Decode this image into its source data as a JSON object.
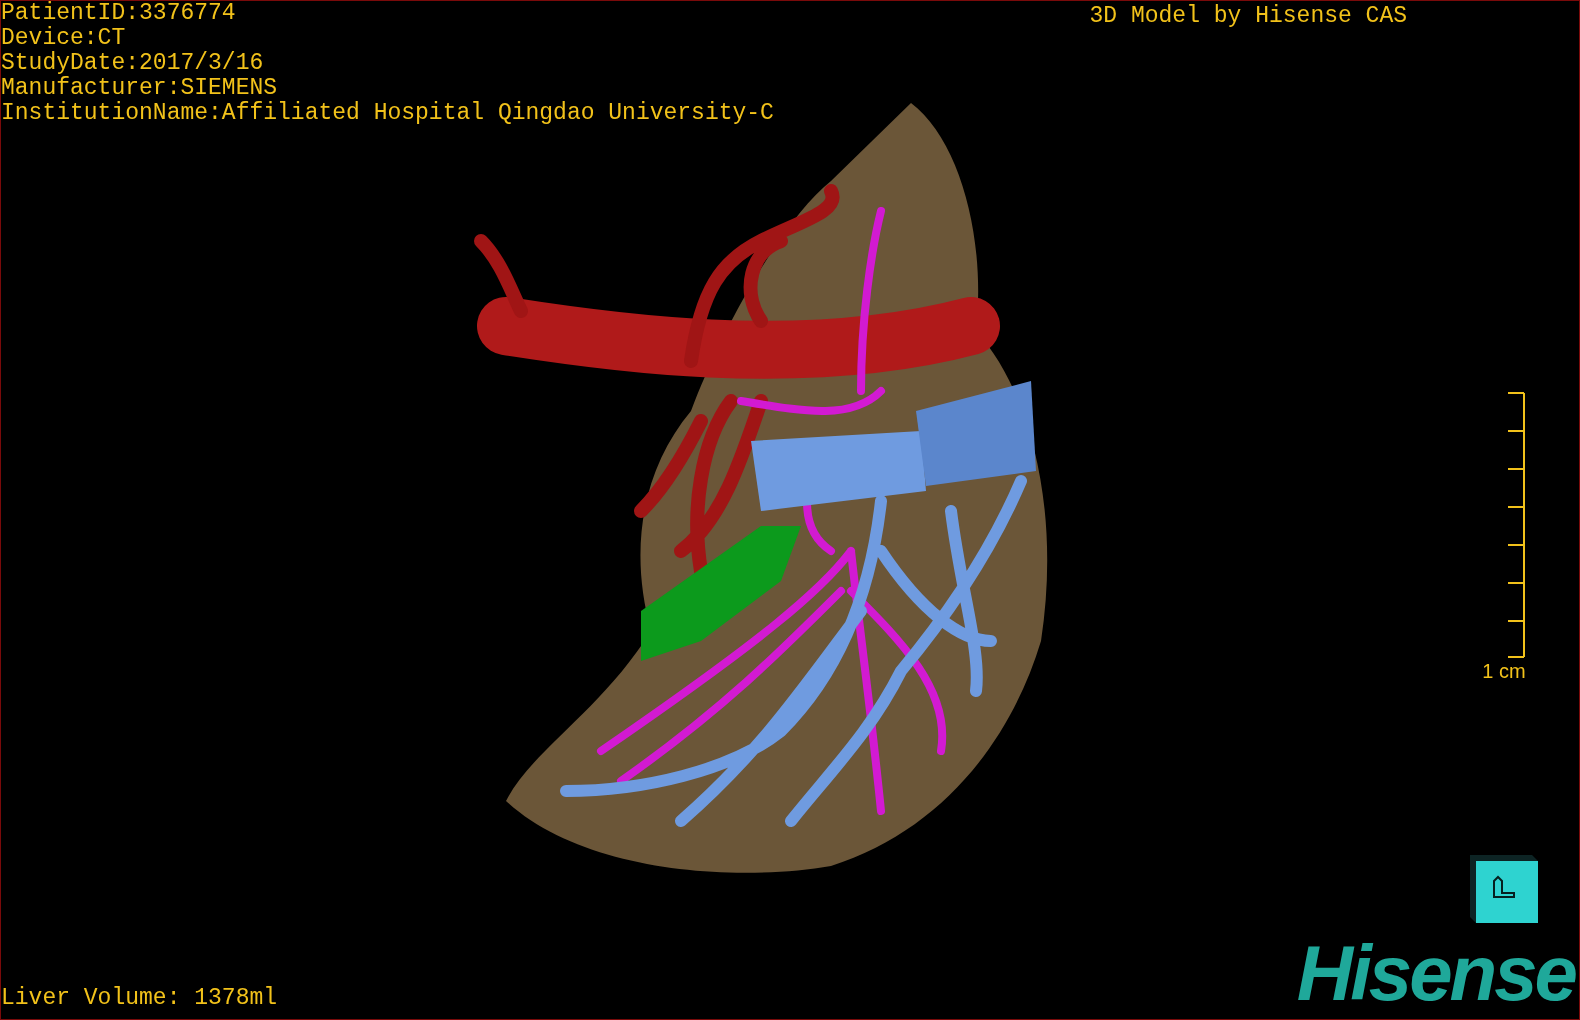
{
  "info_lines": [
    "PatientID:3376774",
    "Device:CT",
    "StudyDate:2017/3/16",
    "Manufacturer:SIEMENS",
    "InstitutionName:Affiliated Hospital Qingdao University-C"
  ],
  "title": "3D Model by Hisense CAS",
  "scale_bar": {
    "label": "1 cm"
  },
  "liver_volume": "Liver Volume: 1378ml",
  "logo": "Hisense"
}
